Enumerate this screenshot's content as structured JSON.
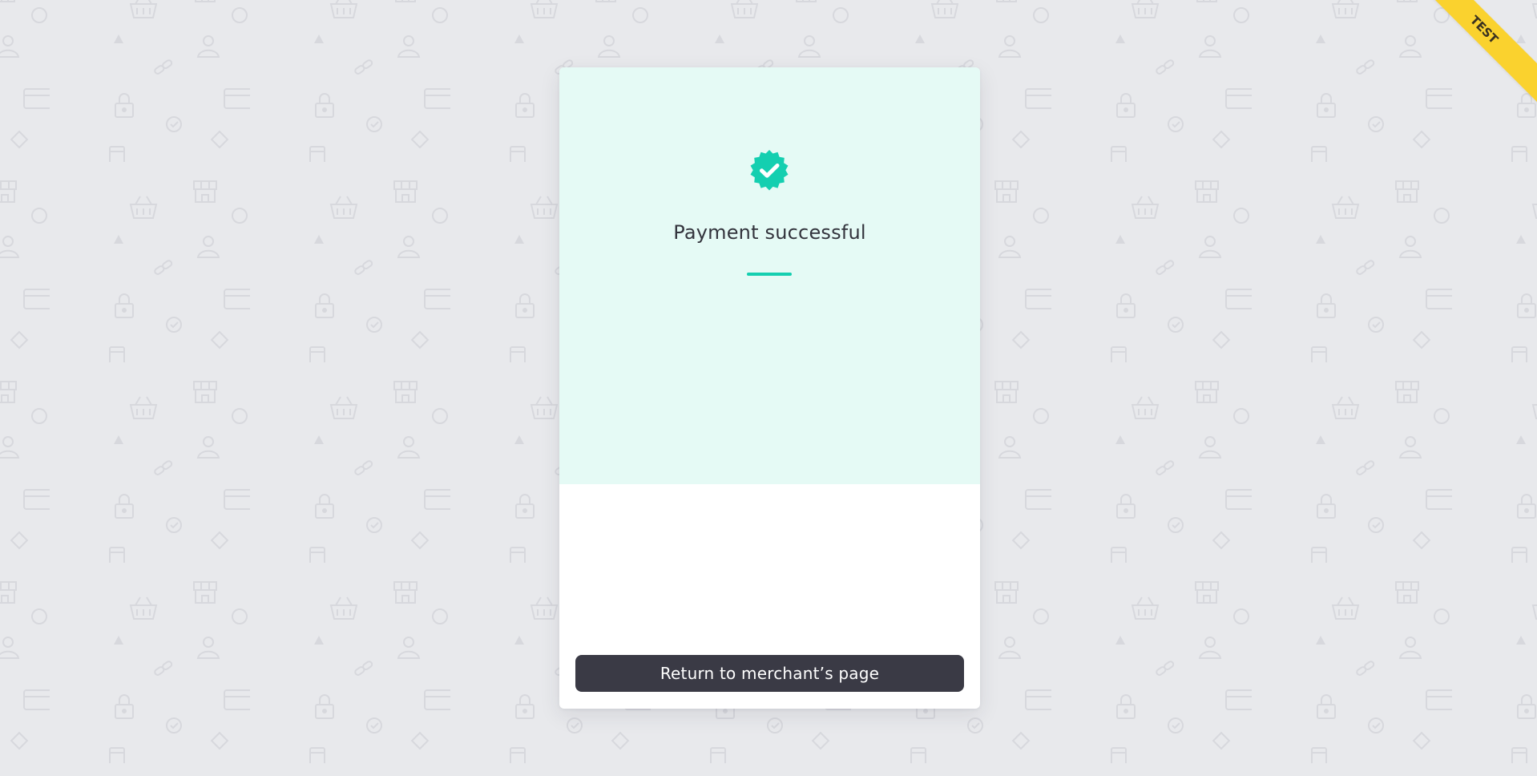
{
  "status": {
    "title": "Payment successful",
    "icon": "verified-check-badge-icon"
  },
  "actions": {
    "return_label": "Return to merchant’s page"
  },
  "environment": {
    "badge_label": "TEST"
  },
  "background": {
    "pattern_icons": [
      "basket-icon",
      "storefront-icon",
      "circle-icon",
      "triangle-icon",
      "user-icon",
      "link-icon",
      "credit-card-icon",
      "lock-icon",
      "check-circle-icon",
      "diamond-icon",
      "mobile-phone-icon"
    ]
  },
  "colors": {
    "accent": "#14cfb0",
    "success_panel": "#e5faf5",
    "button": "#3a3a45",
    "page_background": "#e8e9ec",
    "ribbon": "#fad22e"
  }
}
